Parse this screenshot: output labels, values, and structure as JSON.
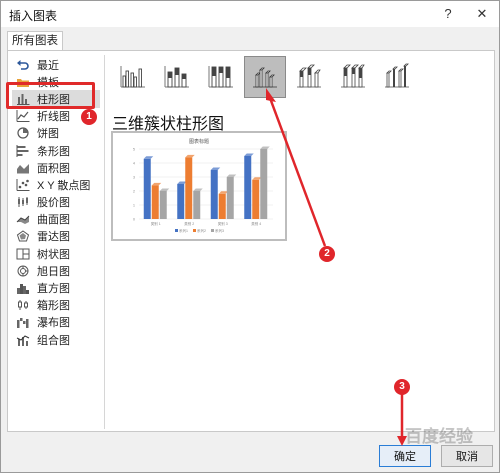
{
  "window": {
    "title": "插入图表",
    "help": "?",
    "close": "✕"
  },
  "tabs": [
    {
      "label": "所有图表"
    }
  ],
  "sidebar": {
    "items": [
      {
        "label": "最近",
        "icon": "undo-icon"
      },
      {
        "label": "模板",
        "icon": "folder-icon"
      },
      {
        "label": "柱形图",
        "icon": "column-chart-icon",
        "selected": true
      },
      {
        "label": "折线图",
        "icon": "line-chart-icon"
      },
      {
        "label": "饼图",
        "icon": "pie-chart-icon"
      },
      {
        "label": "条形图",
        "icon": "bar-chart-icon"
      },
      {
        "label": "面积图",
        "icon": "area-chart-icon"
      },
      {
        "label": "X Y 散点图",
        "icon": "scatter-chart-icon"
      },
      {
        "label": "股价图",
        "icon": "stock-chart-icon"
      },
      {
        "label": "曲面图",
        "icon": "surface-chart-icon"
      },
      {
        "label": "雷达图",
        "icon": "radar-chart-icon"
      },
      {
        "label": "树状图",
        "icon": "treemap-chart-icon"
      },
      {
        "label": "旭日图",
        "icon": "sunburst-chart-icon"
      },
      {
        "label": "直方图",
        "icon": "histogram-chart-icon"
      },
      {
        "label": "箱形图",
        "icon": "box-whisker-chart-icon"
      },
      {
        "label": "瀑布图",
        "icon": "waterfall-chart-icon"
      },
      {
        "label": "组合图",
        "icon": "combo-chart-icon"
      }
    ]
  },
  "subtypes": [
    {
      "icon": "clustered-column-icon",
      "selected": false
    },
    {
      "icon": "stacked-column-icon",
      "selected": false
    },
    {
      "icon": "percent-stacked-column-icon",
      "selected": false
    },
    {
      "icon": "3d-clustered-column-icon",
      "selected": true
    },
    {
      "icon": "3d-stacked-column-icon",
      "selected": false
    },
    {
      "icon": "3d-percent-stacked-column-icon",
      "selected": false
    },
    {
      "icon": "3d-column-icon",
      "selected": false
    }
  ],
  "main": {
    "heading": "三维簇状柱形图"
  },
  "preview": {
    "chart_data": {
      "type": "bar",
      "title": "图表标题",
      "categories": [
        "类别 1",
        "类别 2",
        "类别 3",
        "类别 4"
      ],
      "series": [
        {
          "name": "系列1",
          "values": [
            4.3,
            2.5,
            3.5,
            4.5
          ]
        },
        {
          "name": "系列2",
          "values": [
            2.4,
            4.4,
            1.8,
            2.8
          ]
        },
        {
          "name": "系列3",
          "values": [
            2.0,
            2.0,
            3.0,
            5.0
          ]
        }
      ],
      "ylim": [
        0,
        5
      ],
      "yticks": [
        "0",
        "1",
        "2",
        "3",
        "4",
        "5"
      ],
      "colors": [
        "#4472c4",
        "#ed7d31",
        "#a5a5a5"
      ]
    }
  },
  "annotations": {
    "badges": [
      "1",
      "2",
      "3"
    ],
    "color": "#e0262b"
  },
  "footer": {
    "ok_label": "确定",
    "cancel_label": "取消"
  },
  "watermark": "百度经验"
}
